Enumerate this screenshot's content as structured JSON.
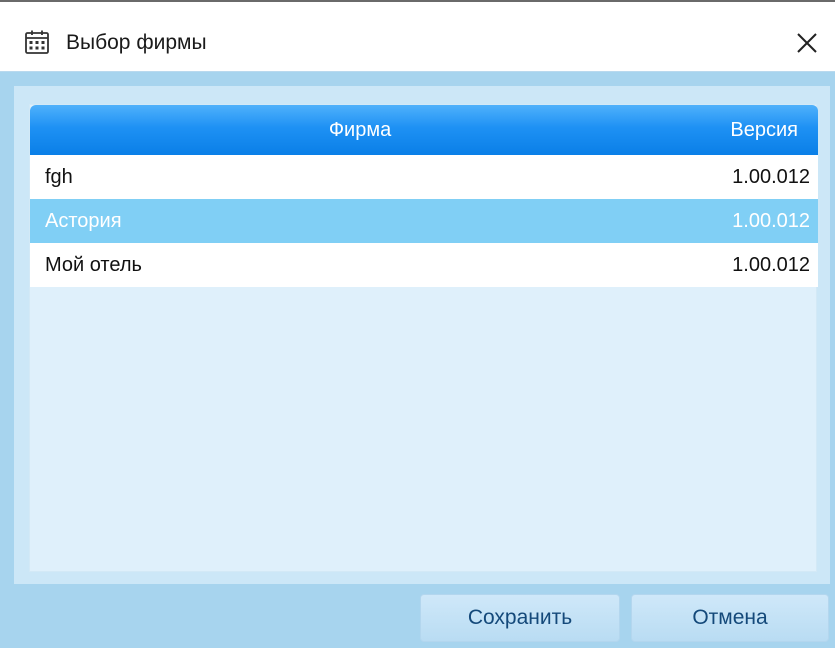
{
  "window": {
    "title": "Выбор фирмы"
  },
  "table": {
    "columns": {
      "firm": "Фирма",
      "version": "Версия"
    },
    "rows": [
      {
        "firm": "fgh",
        "version": "1.00.012"
      },
      {
        "firm": "Астория",
        "version": "1.00.012",
        "selected": true
      },
      {
        "firm": "Мой отель",
        "version": "1.00.012"
      }
    ]
  },
  "buttons": {
    "save": "Сохранить",
    "cancel": "Отмена"
  },
  "colors": {
    "header_accent": "#1e91f4",
    "selected_row": "#80cff5",
    "window_bg": "#a7d4ee"
  },
  "icons": {
    "title": "calendar-icon",
    "close": "close-icon"
  }
}
